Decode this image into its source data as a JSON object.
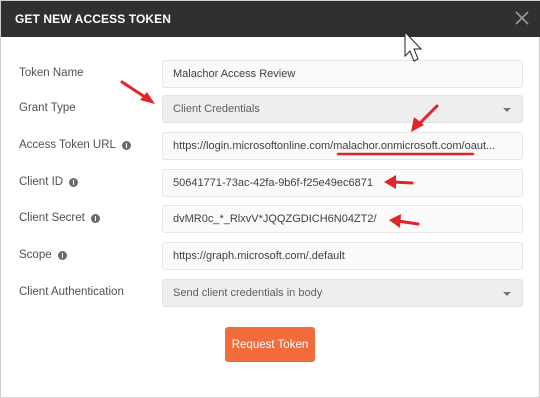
{
  "dialog": {
    "title": "GET NEW ACCESS TOKEN"
  },
  "form": {
    "token_name": {
      "label": "Token Name",
      "value": "Malachor Access Review"
    },
    "grant_type": {
      "label": "Grant Type",
      "value": "Client Credentials"
    },
    "access_token_url": {
      "label": "Access Token URL",
      "value": "https://login.microsoftonline.com/malachor.onmicrosoft.com/oaut..."
    },
    "client_id": {
      "label": "Client ID",
      "value": "50641771-73ac-42fa-9b6f-f25e49ec6871"
    },
    "client_secret": {
      "label": "Client Secret",
      "value": "dvMR0c_*_RlxvV*JQQZGDICH6N04ZT2/"
    },
    "scope": {
      "label": "Scope",
      "value": "https://graph.microsoft.com/.default"
    },
    "client_authentication": {
      "label": "Client Authentication",
      "value": "Send client credentials in body"
    }
  },
  "actions": {
    "request_token_label": "Request Token"
  },
  "colors": {
    "titlebar": "#303030",
    "accent_button": "#f26b3a",
    "annotation_red": "#e0242a"
  },
  "icons": [
    "close-icon",
    "info-icon",
    "dropdown-caret-icon",
    "mouse-cursor-icon"
  ]
}
